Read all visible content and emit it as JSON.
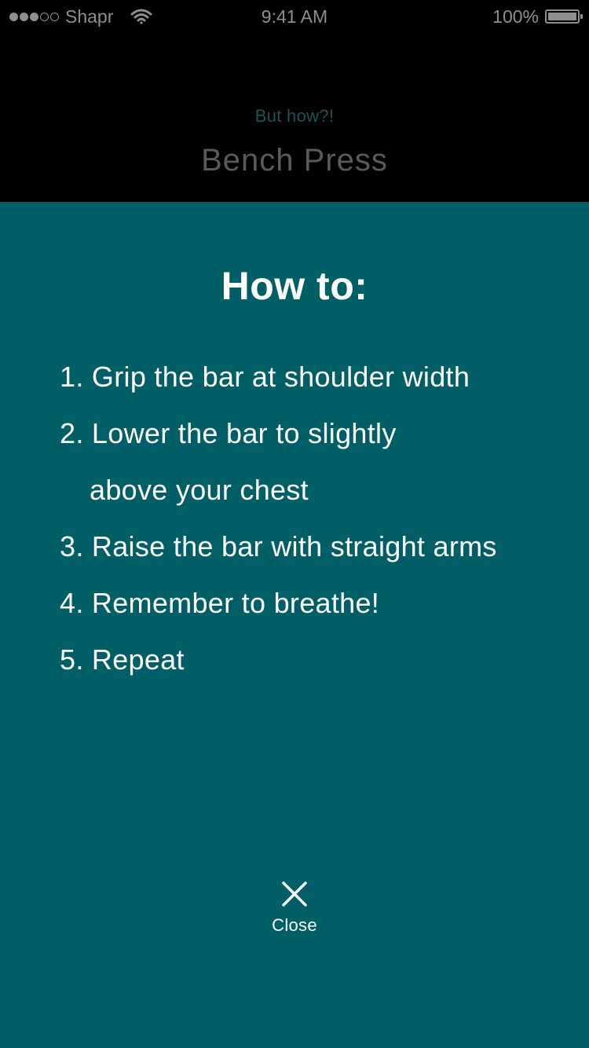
{
  "status_bar": {
    "carrier": "Shapr",
    "time": "9:41 AM",
    "battery": "100%",
    "battery_level": 1.0,
    "signal_filled": 3,
    "signal_total": 5
  },
  "header": {
    "subtitle": "But how?!",
    "title": "Bench Press"
  },
  "panel": {
    "title": "How to:",
    "steps": [
      "1. Grip the bar at shoulder width",
      "2. Lower the bar to slightly",
      "above your chest",
      "3. Raise the bar with straight arms",
      "4. Remember to breathe!",
      "5. Repeat"
    ],
    "close_label": "Close"
  },
  "colors": {
    "panel_background": "#005f66",
    "header_background": "#000000",
    "subtitle_color": "#1a5558",
    "title_color": "#5a5a5a"
  },
  "icons": {
    "close": "close-icon",
    "wifi": "wifi-icon",
    "battery": "battery-icon"
  }
}
